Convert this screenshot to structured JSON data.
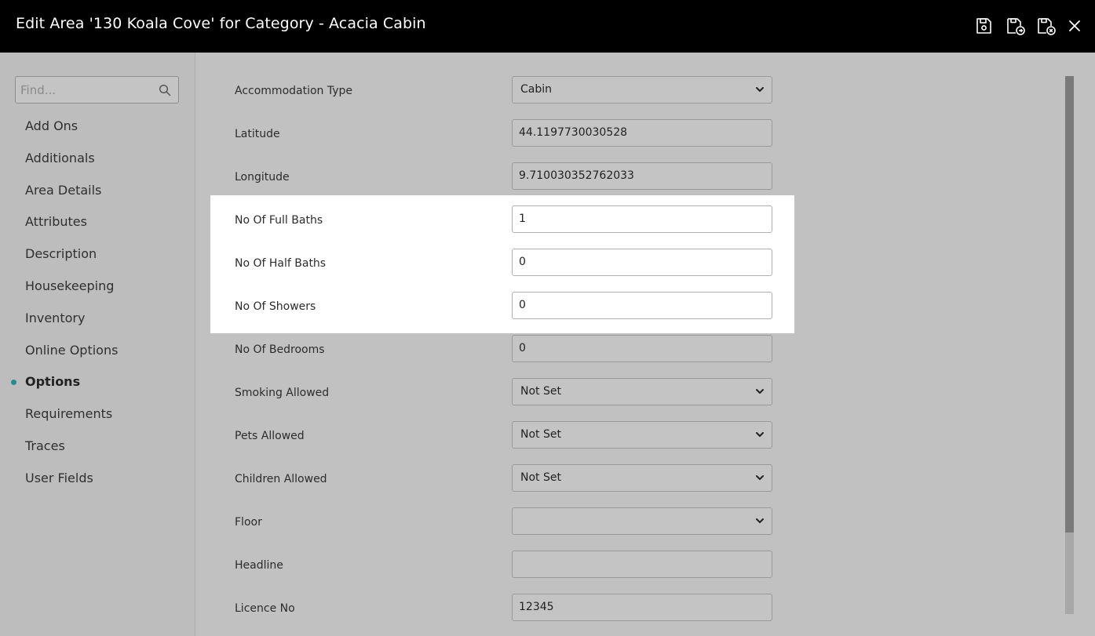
{
  "window": {
    "title": "Edit Area '130 Koala Cove' for Category - Acacia Cabin",
    "toolbar": [
      {
        "name": "save-icon",
        "label": "Save"
      },
      {
        "name": "save-and-next-icon",
        "label": "Save and Next"
      },
      {
        "name": "save-and-close-icon",
        "label": "Save and Close"
      },
      {
        "name": "close-icon",
        "label": "Close"
      }
    ]
  },
  "sidebar": {
    "search": {
      "placeholder": "Find...",
      "value": ""
    },
    "items": [
      {
        "label": "Add Ons",
        "active": false
      },
      {
        "label": "Additionals",
        "active": false
      },
      {
        "label": "Area Details",
        "active": false
      },
      {
        "label": "Attributes",
        "active": false
      },
      {
        "label": "Description",
        "active": false
      },
      {
        "label": "Housekeeping",
        "active": false
      },
      {
        "label": "Inventory",
        "active": false
      },
      {
        "label": "Online Options",
        "active": false
      },
      {
        "label": "Options",
        "active": true
      },
      {
        "label": "Requirements",
        "active": false
      },
      {
        "label": "Traces",
        "active": false
      },
      {
        "label": "User Fields",
        "active": false
      }
    ],
    "accent_color": "#2a8a8e"
  },
  "form": {
    "fields": [
      {
        "label": "Accommodation Type",
        "type": "select",
        "value": "Cabin",
        "highlighted": false
      },
      {
        "label": "Latitude",
        "type": "input",
        "value": "44.1197730030528",
        "highlighted": false
      },
      {
        "label": "Longitude",
        "type": "input",
        "value": "9.710030352762033",
        "highlighted": false
      },
      {
        "label": "No Of Full Baths",
        "type": "input",
        "value": "1",
        "highlighted": true
      },
      {
        "label": "No Of Half Baths",
        "type": "input",
        "value": "0",
        "highlighted": true
      },
      {
        "label": "No Of Showers",
        "type": "input",
        "value": "0",
        "highlighted": true
      },
      {
        "label": "No Of Bedrooms",
        "type": "input",
        "value": "0",
        "highlighted": false
      },
      {
        "label": "Smoking Allowed",
        "type": "select",
        "value": "Not Set",
        "highlighted": false
      },
      {
        "label": "Pets Allowed",
        "type": "select",
        "value": "Not Set",
        "highlighted": false
      },
      {
        "label": "Children Allowed",
        "type": "select",
        "value": "Not Set",
        "highlighted": false
      },
      {
        "label": "Floor",
        "type": "select",
        "value": "",
        "highlighted": false
      },
      {
        "label": "Headline",
        "type": "input",
        "value": "",
        "highlighted": false
      },
      {
        "label": "Licence No",
        "type": "input",
        "value": "12345",
        "highlighted": false
      }
    ]
  }
}
